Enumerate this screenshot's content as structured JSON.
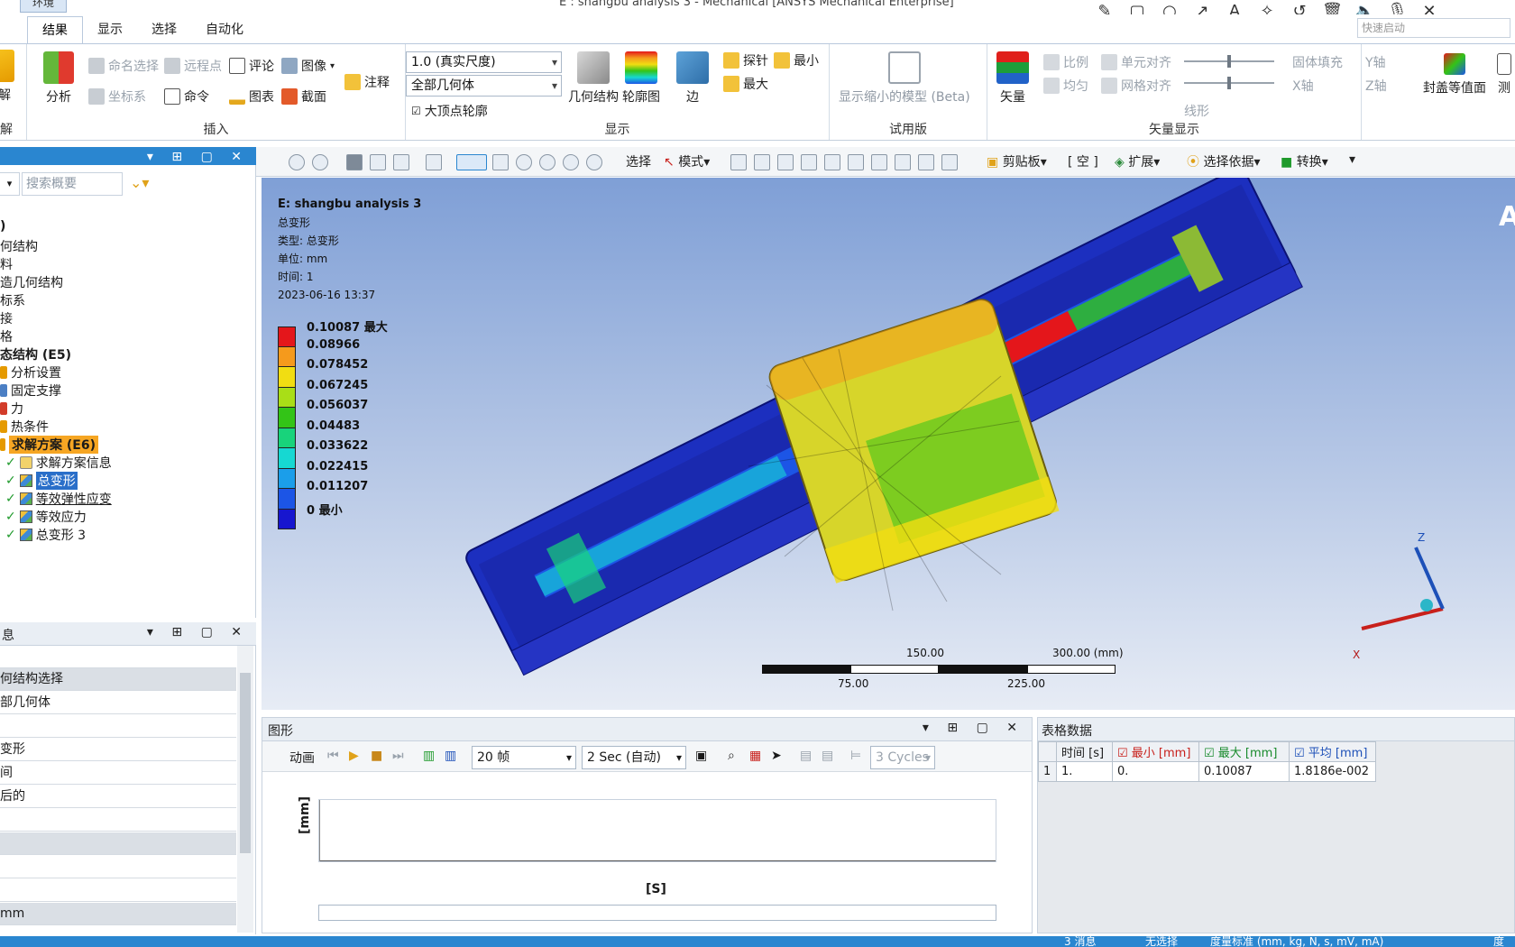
{
  "titlebar": {
    "env_tab": "环境",
    "title": "E : shangbu analysis 3 - Mechanical [ANSYS Mechanical Enterprise]"
  },
  "ribbon_tabs": [
    "结果",
    "显示",
    "选择",
    "自动化"
  ],
  "ribbon_search_placeholder": "快速启动",
  "ribbon": {
    "solve": {
      "label": "解",
      "group": "解"
    },
    "analysis": "分析",
    "insert": {
      "named_selection": "命名选择",
      "remote_point": "远程点",
      "comment": "评论",
      "image": "图像",
      "coordinate": "坐标系",
      "command": "命令",
      "chart": "图表",
      "section": "截面",
      "annotation": "注释",
      "group": "插入"
    },
    "display": {
      "scale_combo": "1.0 (真实尺度)",
      "geometry_combo": "全部几何体",
      "vertex_contour": "大顶点轮廓",
      "geometry": "几何结构",
      "contour": "轮廓图",
      "edge": "边",
      "probe": "探针",
      "min": "最小",
      "max": "最大",
      "group": "显示"
    },
    "trial": {
      "show_undeformed": "显示缩小的模型 (Beta)",
      "group": "试用版"
    },
    "vector": {
      "vector": "矢量",
      "scale": "比例",
      "uniform": "均匀",
      "element_align": "单元对齐",
      "grid_align": "网格对齐",
      "line": "线形",
      "solid_fill": "固体填充",
      "y_axis": "Y轴",
      "x_axis": "X轴",
      "z_axis": "Z轴",
      "group": "矢量显示"
    },
    "capped_isosurface": "封盖等值面",
    "measure": "测"
  },
  "outline": {
    "search_placeholder": "搜索概要",
    "items": [
      {
        "label": ")"
      },
      {
        "label": "何结构"
      },
      {
        "label": "料"
      },
      {
        "label": "造几何结构"
      },
      {
        "label": "标系"
      },
      {
        "label": "接"
      },
      {
        "label": "格"
      },
      {
        "label": "态结构 (E5)"
      },
      {
        "label": "分析设置"
      },
      {
        "label": "固定支撑"
      },
      {
        "label": "力"
      },
      {
        "label": "热条件"
      },
      {
        "label": "求解方案 (E6)"
      },
      {
        "label": "求解方案信息"
      },
      {
        "label": "总变形"
      },
      {
        "label": "等效弹性应变"
      },
      {
        "label": "等效应力"
      },
      {
        "label": "总变形 3"
      }
    ]
  },
  "details": {
    "header": "息",
    "rows": [
      "",
      "何结构选择",
      "部几何体",
      "",
      "变形",
      "间",
      "后的",
      "",
      "",
      "",
      "",
      "mm"
    ]
  },
  "gfx_toolbar": {
    "select": "选择",
    "mode": "模式",
    "clipboard": "剪贴板",
    "empty": "[ 空 ]",
    "expand": "扩展",
    "select_by": "选择依据",
    "convert": "转换"
  },
  "viewport": {
    "title": "E: shangbu analysis 3",
    "result_type": "总变形",
    "type_line": "类型: 总变形",
    "unit_line": "单位: mm",
    "time_line": "时间: 1",
    "date_line": "2023-06-16 13:37",
    "legend": [
      {
        "value": "0.10087 最大",
        "color": "#e4161b"
      },
      {
        "value": "0.08966",
        "color": "#f59a1c"
      },
      {
        "value": "0.078452",
        "color": "#f1dd12"
      },
      {
        "value": "0.067245",
        "color": "#a9de17"
      },
      {
        "value": "0.056037",
        "color": "#33c417"
      },
      {
        "value": "0.04483",
        "color": "#18d37b"
      },
      {
        "value": "0.033622",
        "color": "#16d8d2"
      },
      {
        "value": "0.022415",
        "color": "#1b9eea"
      },
      {
        "value": "0.011207",
        "color": "#1c55e6"
      },
      {
        "value": "0 最小",
        "color": "#1716cf"
      }
    ],
    "scale_labels": {
      "top_mid": "150.00",
      "top_right": "300.00 (mm)",
      "bottom_left": "75.00",
      "bottom_right": "225.00"
    },
    "triad": {
      "z": "Z",
      "x": "X"
    },
    "logo_letter": "A"
  },
  "graph": {
    "title": "图形",
    "animation": "动画",
    "frames": "20 帧",
    "duration": "2 Sec (自动)",
    "cycles": "3 Cycles",
    "y_label": "[mm]",
    "x_label": "[S]"
  },
  "table": {
    "title": "表格数据",
    "headers": [
      "时间 [s]",
      "最小 [mm]",
      "最大 [mm]",
      "平均 [mm]"
    ],
    "rows": [
      [
        "1",
        "1.",
        "0.",
        "0.10087",
        "1.8186e-002"
      ]
    ]
  },
  "status": {
    "messages": "3 消息",
    "selection": "无选择",
    "units": "度量标准 (mm, kg, N, s, mV, mA)",
    "extra": "度"
  }
}
